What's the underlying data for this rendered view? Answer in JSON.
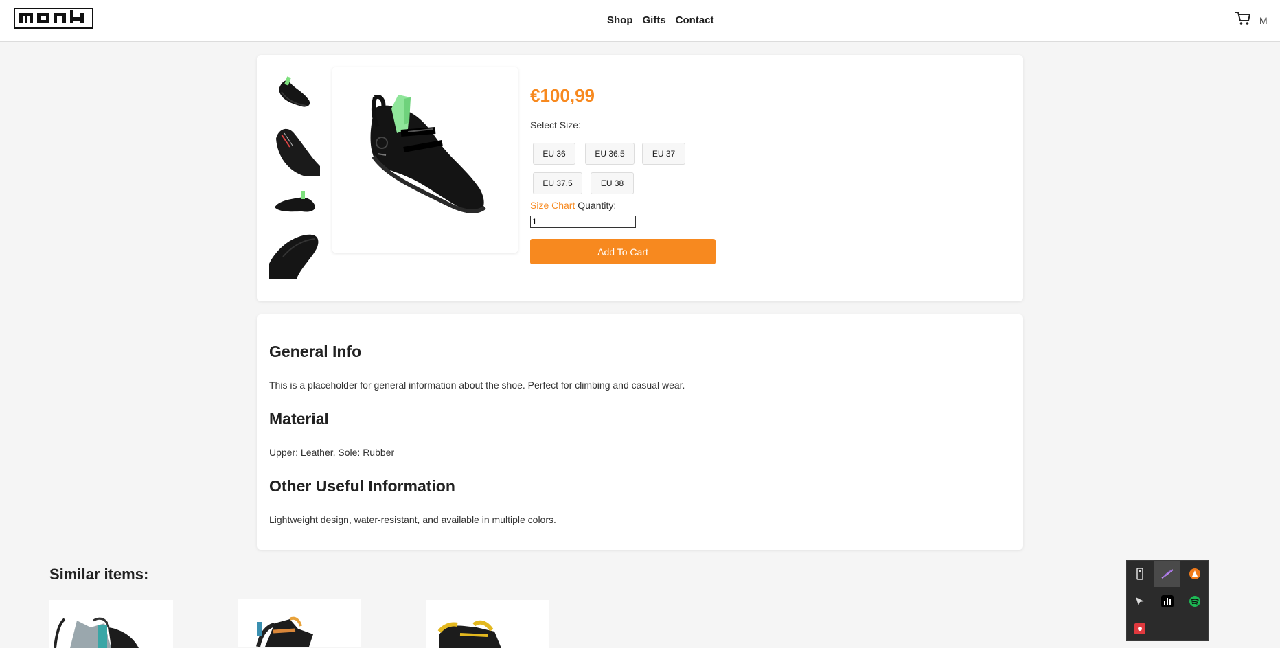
{
  "header": {
    "logo_text": "monk",
    "nav": [
      "Shop",
      "Gifts",
      "Contact"
    ],
    "user_initial": "M"
  },
  "product": {
    "price": "€100,99",
    "select_size_label": "Select Size:",
    "sizes": [
      "EU 36",
      "EU 36.5",
      "EU 37",
      "EU 37.5",
      "EU 38"
    ],
    "size_chart_label": "Size Chart",
    "quantity_label": "Quantity:",
    "quantity_value": "1",
    "add_to_cart_label": "Add To Cart"
  },
  "description": {
    "general_heading": "General Info",
    "general_text": "This is a placeholder for general information about the shoe. Perfect for climbing and casual wear.",
    "material_heading": "Material",
    "material_text": "Upper: Leather, Sole: Rubber",
    "other_heading": "Other Useful Information",
    "other_text": "Lightweight design, water-resistant, and available in multiple colors."
  },
  "similar": {
    "title": "Similar items:"
  },
  "tray": {
    "icons": [
      "usb-drive-icon",
      "feather-icon",
      "vlc-icon",
      "cursor-icon",
      "audio-bars-icon",
      "spotify-icon",
      "screen-record-icon"
    ]
  },
  "colors": {
    "accent": "#f7891f"
  }
}
